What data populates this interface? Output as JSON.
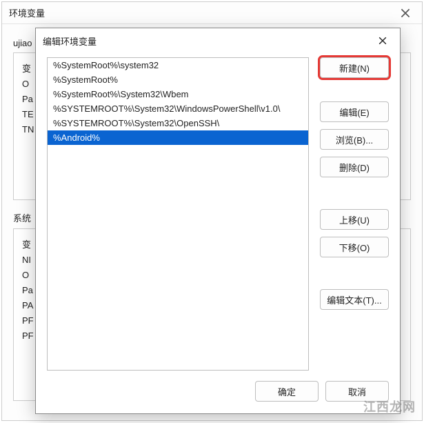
{
  "back": {
    "title": "环境变量",
    "user_label": "ujiao",
    "sys_label": "系统",
    "user_stubs": [
      "变",
      "O",
      "Pa",
      "TE",
      "TN"
    ],
    "sys_stubs": [
      "变",
      "NI",
      "O",
      "Pa",
      "PA",
      "PF",
      "PF"
    ]
  },
  "front": {
    "title": "编辑环境变量",
    "list": [
      {
        "text": "%SystemRoot%\\system32",
        "selected": false
      },
      {
        "text": "%SystemRoot%",
        "selected": false
      },
      {
        "text": "%SystemRoot%\\System32\\Wbem",
        "selected": false
      },
      {
        "text": "%SYSTEMROOT%\\System32\\WindowsPowerShell\\v1.0\\",
        "selected": false
      },
      {
        "text": "%SYSTEMROOT%\\System32\\OpenSSH\\",
        "selected": false
      },
      {
        "text": "%Android%",
        "selected": true
      }
    ],
    "buttons": {
      "new": "新建(N)",
      "edit": "编辑(E)",
      "browse": "浏览(B)...",
      "delete": "删除(D)",
      "up": "上移(U)",
      "down": "下移(O)",
      "edit_text": "编辑文本(T)...",
      "ok": "确定",
      "cancel": "取消"
    }
  },
  "watermark": "江西龙网"
}
